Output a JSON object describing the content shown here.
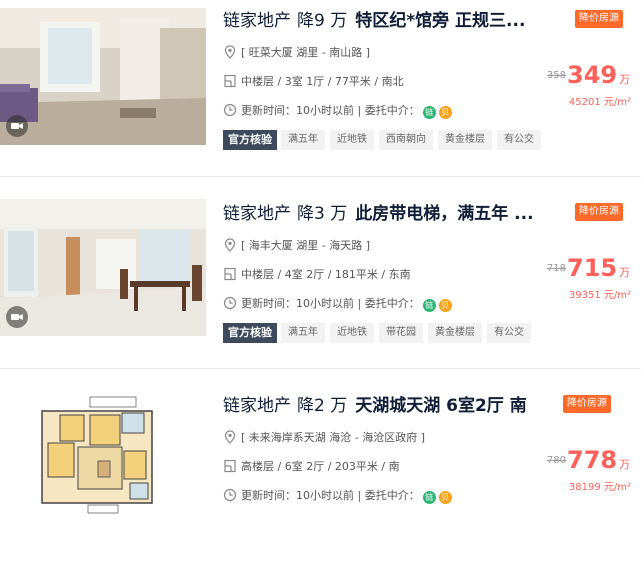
{
  "listings": [
    {
      "agency": "链家地产",
      "drop": "降9 万",
      "headline": "特区纪*馆旁 正规三...",
      "tag_reduce": "降价房源",
      "location": "[ 旺菜大厦 湖里 - 南山路 ]",
      "spec": "中楼层 / 3室 1厅 / 77平米 / 南北",
      "update": "更新时间：10小时以前 | 委托中介：",
      "official": "官方核验",
      "tags": [
        "满五年",
        "近地铁",
        "西南朝向",
        "黄金楼层",
        "有公交"
      ],
      "old_price": "358",
      "price": "349",
      "price_unit": "万",
      "unit_price": "45201 元/m²"
    },
    {
      "agency": "链家地产",
      "drop": "降3 万",
      "headline": "此房带电梯，满五年 ...",
      "tag_reduce": "降价房源",
      "location": "[ 海丰大厦 湖里 - 海天路 ]",
      "spec": "中楼层 / 4室 2厅 / 181平米 / 东南",
      "update": "更新时间：10小时以前 | 委托中介：",
      "official": "官方核验",
      "tags": [
        "满五年",
        "近地铁",
        "带花园",
        "黄金楼层",
        "有公交"
      ],
      "old_price": "718",
      "price": "715",
      "price_unit": "万",
      "unit_price": "39351 元/m²"
    },
    {
      "agency": "链家地产",
      "drop": "降2 万",
      "headline": "天湖城天湖 6室2厅 南",
      "tag_reduce": "降价房源",
      "location": "[ 未来海岸系天湖 海沧 - 海沧区政府 ]",
      "spec": "高楼层 / 6室 2厅 / 203平米 / 南",
      "update": "更新时间：10小时以前 | 委托中介：",
      "old_price": "780",
      "price": "778",
      "price_unit": "万",
      "unit_price": "38199 元/m²"
    }
  ],
  "badges": {
    "green": "链",
    "orange": "贝"
  },
  "colors": {
    "accent": "#fe615a",
    "reduce_tag": "#ff6a2b",
    "official": "#3d4a5c"
  },
  "icons": {
    "location": "location-pin-icon",
    "spec": "floorplan-icon",
    "time": "clock-icon",
    "vr": "vr-camera-icon"
  }
}
